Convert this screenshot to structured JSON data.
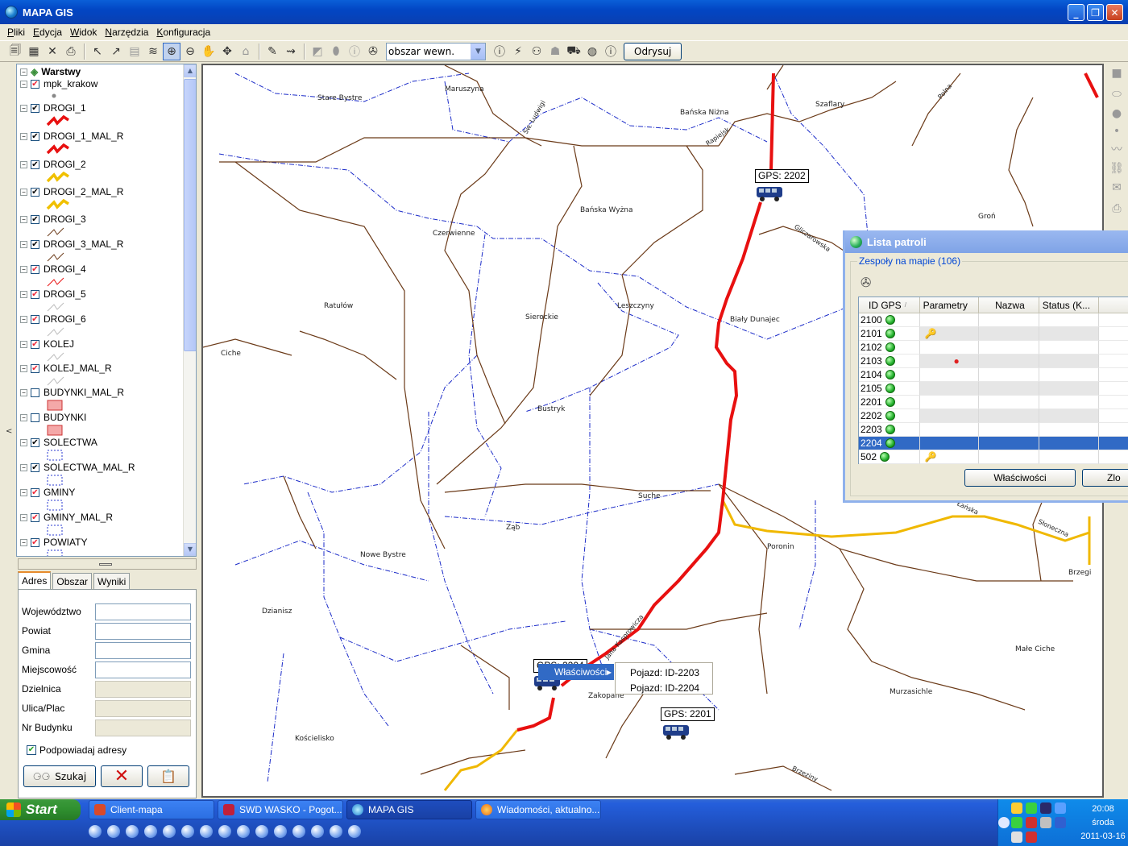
{
  "window": {
    "title": "MAPA GIS"
  },
  "menu": [
    "Pliki",
    "Edycja",
    "Widok",
    "Narzędzia",
    "Konfiguracja"
  ],
  "toolbar": {
    "area_select_value": "obszar wewn.",
    "redraw_label": "Odrysuj"
  },
  "layers": {
    "root": "Warstwy",
    "items": [
      {
        "name": "mpk_krakow",
        "checked": true,
        "symbol": "dot"
      },
      {
        "name": "DROGI_1",
        "checked": true,
        "symbol": "red-thick"
      },
      {
        "name": "DROGI_1_MAL_R",
        "checked": true,
        "symbol": "red-thick"
      },
      {
        "name": "DROGI_2",
        "checked": true,
        "symbol": "yellow-thick"
      },
      {
        "name": "DROGI_2_MAL_R",
        "checked": true,
        "symbol": "yellow-thick"
      },
      {
        "name": "DROGI_3",
        "checked": true,
        "symbol": "brown-thin"
      },
      {
        "name": "DROGI_3_MAL_R",
        "checked": true,
        "symbol": "brown-thin"
      },
      {
        "name": "DROGI_4",
        "checked": true,
        "symbol": "red-thin"
      },
      {
        "name": "DROGI_5",
        "checked": true,
        "symbol": "grey-thin"
      },
      {
        "name": "DROGI_6",
        "checked": true,
        "symbol": "grey-thin"
      },
      {
        "name": "KOLEJ",
        "checked": true,
        "symbol": "grey-thin"
      },
      {
        "name": "KOLEJ_MAL_R",
        "checked": true,
        "symbol": "grey-thin"
      },
      {
        "name": "BUDYNKI_MAL_R",
        "checked": false,
        "symbol": "pink-box"
      },
      {
        "name": "BUDYNKI",
        "checked": false,
        "symbol": "pink-box"
      },
      {
        "name": "SOLECTWA",
        "checked": true,
        "symbol": "dashed-box"
      },
      {
        "name": "SOLECTWA_MAL_R",
        "checked": true,
        "symbol": "dashed-box"
      },
      {
        "name": "GMINY",
        "checked": true,
        "symbol": "dashed-box"
      },
      {
        "name": "GMINY_MAL_R",
        "checked": true,
        "symbol": "dashed-box"
      },
      {
        "name": "POWIATY",
        "checked": true,
        "symbol": "dashed-box"
      }
    ]
  },
  "search": {
    "tabs": [
      "Adres",
      "Obszar",
      "Wyniki"
    ],
    "fields": [
      {
        "label": "Województwo",
        "value": "",
        "enabled": true
      },
      {
        "label": "Powiat",
        "value": "",
        "enabled": true
      },
      {
        "label": "Gmina",
        "value": "",
        "enabled": true
      },
      {
        "label": "Miejscowość",
        "value": "",
        "enabled": true
      },
      {
        "label": "Dzielnica",
        "value": "",
        "enabled": false
      },
      {
        "label": "Ulica/Plac",
        "value": "",
        "enabled": false
      },
      {
        "label": "Nr Budynku",
        "value": "",
        "enabled": false
      }
    ],
    "suggest_label": "Podpowiadaj adresy",
    "search_button": "Szukaj"
  },
  "map": {
    "places": [
      "Maruszyna",
      "Stare Bystre",
      "Bańska Niżna",
      "Szaflary",
      "Czerwienne",
      "Bańska Wyżna",
      "Groń",
      "Ratułów",
      "Sierockie",
      "Leszczyny",
      "Biały Dunajec",
      "Ciche",
      "Bustryk",
      "Suche",
      "Ząb",
      "Poronin",
      "Nowe Bystre",
      "Dzianisz",
      "Zakopane",
      "Murzasichle",
      "Małe Ciche",
      "Kościelisko",
      "Brzegi"
    ],
    "streets": [
      "Sw. Ludwigi",
      "Rapiejsk",
      "Gliczarowska",
      "Polna",
      "Jana Kasprowicza",
      "Słoneczna",
      "Brzeziny",
      "Łańska"
    ],
    "gps_labels": [
      "GPS: 2202",
      "GPS: 2204",
      "GPS: 2201"
    ]
  },
  "patrol_window": {
    "title": "Lista patroli",
    "group_label": "Zespoły na mapie  (106)",
    "columns": [
      "ID GPS",
      "Parametry",
      "Nazwa",
      "Status (K..."
    ],
    "rows": [
      {
        "id": "2100",
        "param": ""
      },
      {
        "id": "2101",
        "param": "key"
      },
      {
        "id": "2102",
        "param": ""
      },
      {
        "id": "2103",
        "param": "alarm"
      },
      {
        "id": "2104",
        "param": ""
      },
      {
        "id": "2105",
        "param": ""
      },
      {
        "id": "2201",
        "param": ""
      },
      {
        "id": "2202",
        "param": ""
      },
      {
        "id": "2203",
        "param": ""
      },
      {
        "id": "2204",
        "param": "",
        "selected": true
      },
      {
        "id": "502",
        "param": "key"
      }
    ],
    "btn_properties": "Właściwości",
    "btn_second": "Zlo"
  },
  "context_menu": {
    "item": "Właściwości",
    "submenu": [
      "Pojazd: ID-2203",
      "Pojazd: ID-2204"
    ]
  },
  "taskbar": {
    "start": "Start",
    "tasks": [
      "Client-mapa",
      "SWD WASKO - Pogot...",
      "MAPA GIS",
      "Wiadomości, aktualno..."
    ],
    "time": "20:08",
    "day": "środa",
    "date": "2011-03-16"
  }
}
